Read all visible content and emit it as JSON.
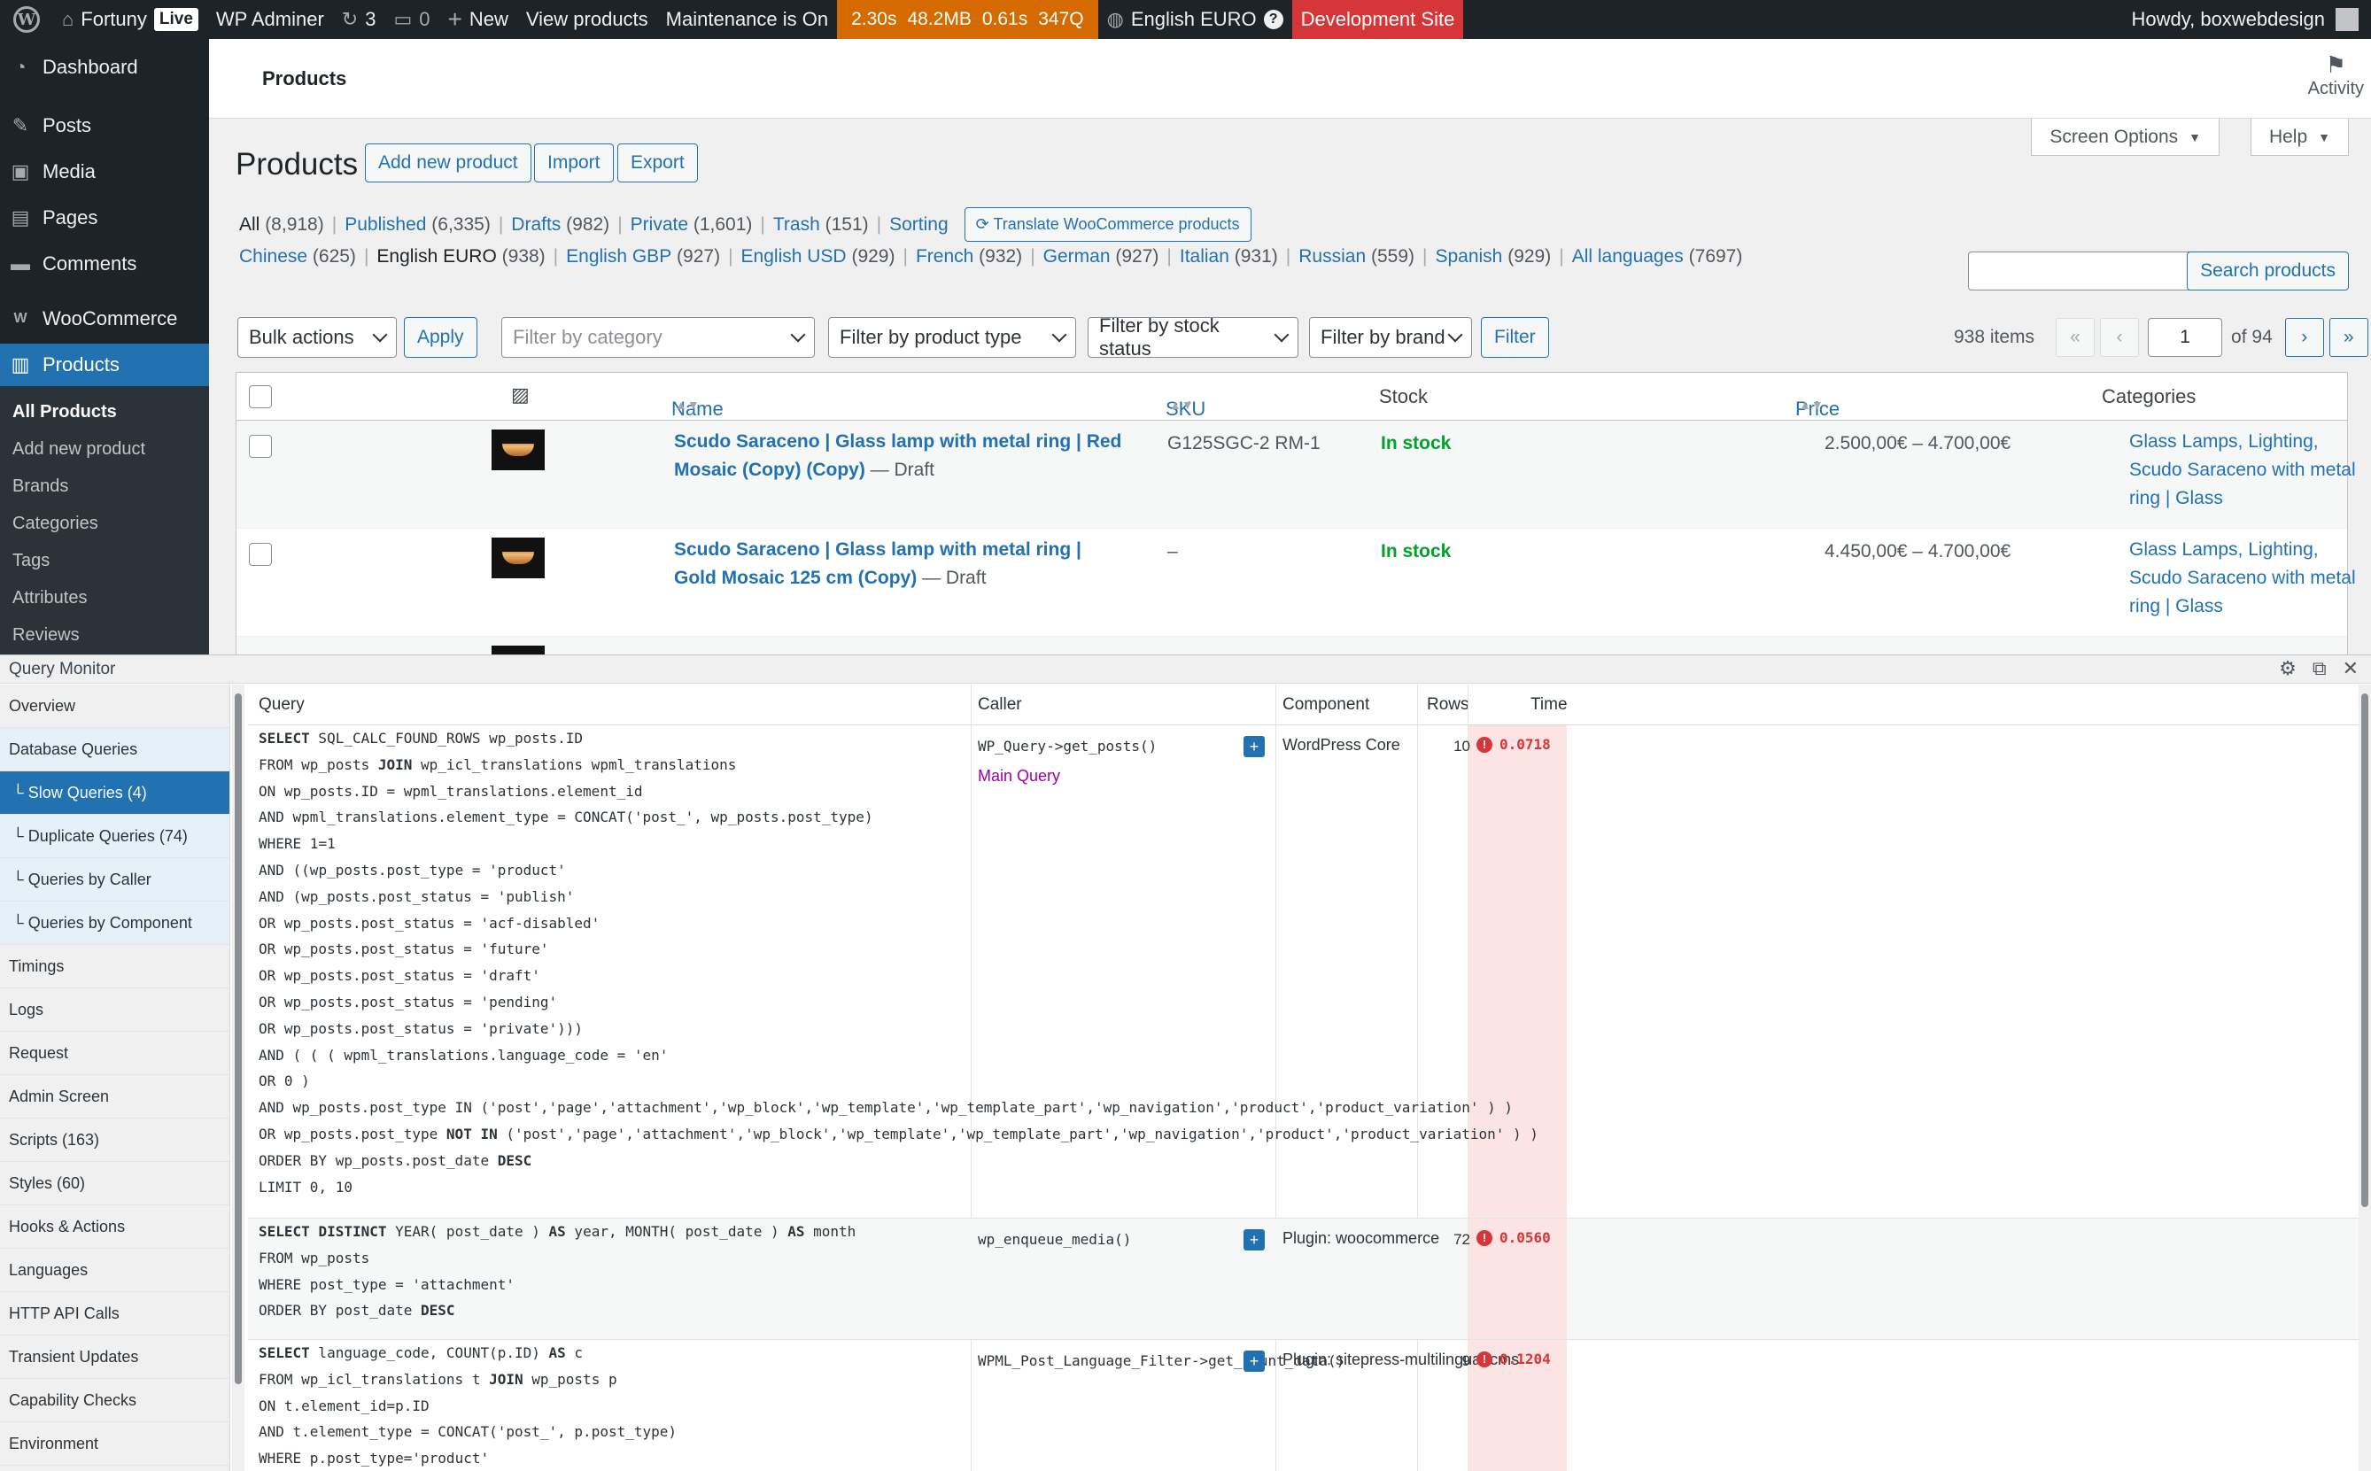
{
  "adminbar": {
    "site": "Fortuny",
    "live": "Live",
    "wpadminer": "WP Adminer",
    "updates": "3",
    "comments": "0",
    "new": "New",
    "view_products": "View products",
    "maintenance": "Maintenance is On",
    "qm": [
      "2.30s",
      "48.2MB",
      "0.61s",
      "347Q"
    ],
    "language": "English EURO",
    "dev_site": "Development Site",
    "howdy": "Howdy, boxwebdesign"
  },
  "sidebar": {
    "items": [
      {
        "label": "Dashboard",
        "icon": "dashboard-icon"
      },
      {
        "label": "Posts",
        "icon": "pin-icon"
      },
      {
        "label": "Media",
        "icon": "media-icon"
      },
      {
        "label": "Pages",
        "icon": "pages-icon"
      },
      {
        "label": "Comments",
        "icon": "comment-icon"
      },
      {
        "label": "WooCommerce",
        "icon": "woo-icon"
      },
      {
        "label": "Products",
        "icon": "archive-icon"
      }
    ],
    "submenu": [
      "All Products",
      "Add new product",
      "Brands",
      "Categories",
      "Tags",
      "Attributes",
      "Reviews"
    ]
  },
  "screen": {
    "title": "Products",
    "activity": "Activity",
    "screen_options": "Screen Options",
    "help": "Help"
  },
  "page": {
    "heading": "Products",
    "add_new": "Add new product",
    "import": "Import",
    "export": "Export",
    "views": [
      {
        "label": "All",
        "count": "(8,918)",
        "current": true
      },
      {
        "label": "Published",
        "count": "(6,335)"
      },
      {
        "label": "Drafts",
        "count": "(982)"
      },
      {
        "label": "Private",
        "count": "(1,601)"
      },
      {
        "label": "Trash",
        "count": "(151)"
      },
      {
        "label": "Sorting",
        "count": ""
      }
    ],
    "translate_btn": "Translate WooCommerce products",
    "languages": [
      {
        "label": "Chinese",
        "count": "(625)"
      },
      {
        "label": "English EURO",
        "count": "(938)",
        "current": true
      },
      {
        "label": "English GBP",
        "count": "(927)"
      },
      {
        "label": "English USD",
        "count": "(929)"
      },
      {
        "label": "French",
        "count": "(932)"
      },
      {
        "label": "German",
        "count": "(927)"
      },
      {
        "label": "Italian",
        "count": "(931)"
      },
      {
        "label": "Russian",
        "count": "(559)"
      },
      {
        "label": "Spanish",
        "count": "(929)"
      },
      {
        "label": "All languages",
        "count": "(7697)"
      }
    ],
    "search_btn": "Search products",
    "bulk_actions": "Bulk actions",
    "apply": "Apply",
    "filter_category": "Filter by category",
    "filter_type": "Filter by product type",
    "filter_stock": "Filter by stock status",
    "filter_brand": "Filter by brand",
    "filter": "Filter",
    "items": "938 items",
    "page_num": "1",
    "of_pages": "of 94",
    "first": "«",
    "prev": "‹",
    "next": "›",
    "last": "»"
  },
  "table": {
    "headers": {
      "name": "Name",
      "sku": "SKU",
      "stock": "Stock",
      "price": "Price",
      "categories": "Categories"
    },
    "rows": [
      {
        "name": "Scudo Saraceno | Glass lamp with metal ring | Red Mosaic (Copy) (Copy)",
        "status": " — Draft",
        "sku": "G125SGC-2 RM-1",
        "stock": "In stock",
        "price": "2.500,00€ – 4.700,00€",
        "categories": "Glass Lamps, Lighting, Scudo Saraceno with metal ring | Glass"
      },
      {
        "name": "Scudo Saraceno | Glass lamp with metal ring | Gold Mosaic 125 cm (Copy)",
        "status": " — Draft",
        "sku": "–",
        "stock": "In stock",
        "price": "4.450,00€ – 4.700,00€",
        "categories": "Glass Lamps, Lighting, Scudo Saraceno with metal ring | Glass"
      }
    ]
  },
  "qm": {
    "title": "Query Monitor",
    "nav": [
      "Overview",
      "Database Queries",
      "└ Slow Queries (4)",
      "└ Duplicate Queries (74)",
      "└ Queries by Caller",
      "└ Queries by Component",
      "Timings",
      "Logs",
      "Request",
      "Admin Screen",
      "Scripts (163)",
      "Styles (60)",
      "Hooks & Actions",
      "Languages",
      "HTTP API Calls",
      "Transient Updates",
      "Capability Checks",
      "Environment"
    ],
    "headers": {
      "query": "Query",
      "caller": "Caller",
      "component": "Component",
      "rows": "Rows",
      "time": "Time"
    },
    "queries": [
      {
        "sql": [
          "SELECT SQL_CALC_FOUND_ROWS wp_posts.ID",
          "FROM wp_posts JOIN wp_icl_translations wpml_translations",
          "ON wp_posts.ID = wpml_translations.element_id",
          "AND wpml_translations.element_type = CONCAT('post_', wp_posts.post_type)",
          "WHERE 1=1",
          "AND ((wp_posts.post_type = 'product'",
          "AND (wp_posts.post_status = 'publish'",
          "OR wp_posts.post_status = 'acf-disabled'",
          "OR wp_posts.post_status = 'future'",
          "OR wp_posts.post_status = 'draft'",
          "OR wp_posts.post_status = 'pending'",
          "OR wp_posts.post_status = 'private')))",
          "AND ( ( ( wpml_translations.language_code = 'en'",
          "OR 0 )",
          "AND wp_posts.post_type IN ('post','page','attachment','wp_block','wp_template','wp_template_part','wp_navigation','product','product_variation' ) )",
          "OR wp_posts.post_type NOT IN ('post','page','attachment','wp_block','wp_template','wp_template_part','wp_navigation','product','product_variation' ) )",
          "ORDER BY wp_posts.post_date DESC",
          "LIMIT 0, 10"
        ],
        "caller": "WP_Query->get_posts()",
        "caller_note": "Main Query",
        "component": "WordPress Core",
        "rows": "10",
        "time": "0.0718"
      },
      {
        "sql": [
          "SELECT DISTINCT YEAR( post_date ) AS year, MONTH( post_date ) AS month",
          "FROM wp_posts",
          "WHERE post_type = 'attachment'",
          "ORDER BY post_date DESC"
        ],
        "caller": "wp_enqueue_media()",
        "caller_note": "",
        "component": "Plugin: woocommerce",
        "rows": "72",
        "time": "0.0560"
      },
      {
        "sql": [
          "SELECT language_code, COUNT(p.ID) AS c",
          "FROM wp_icl_translations t JOIN wp_posts p",
          "ON t.element_id=p.ID",
          "AND t.element_type = CONCAT('post_', p.post_type)",
          "WHERE p.post_type='product'"
        ],
        "caller": "WPML_Post_Language_Filter->get_count_data()",
        "caller_note": "",
        "component": "Plugin: sitepress-multilingual-cms",
        "rows": "9",
        "time": "0.1204"
      }
    ]
  }
}
